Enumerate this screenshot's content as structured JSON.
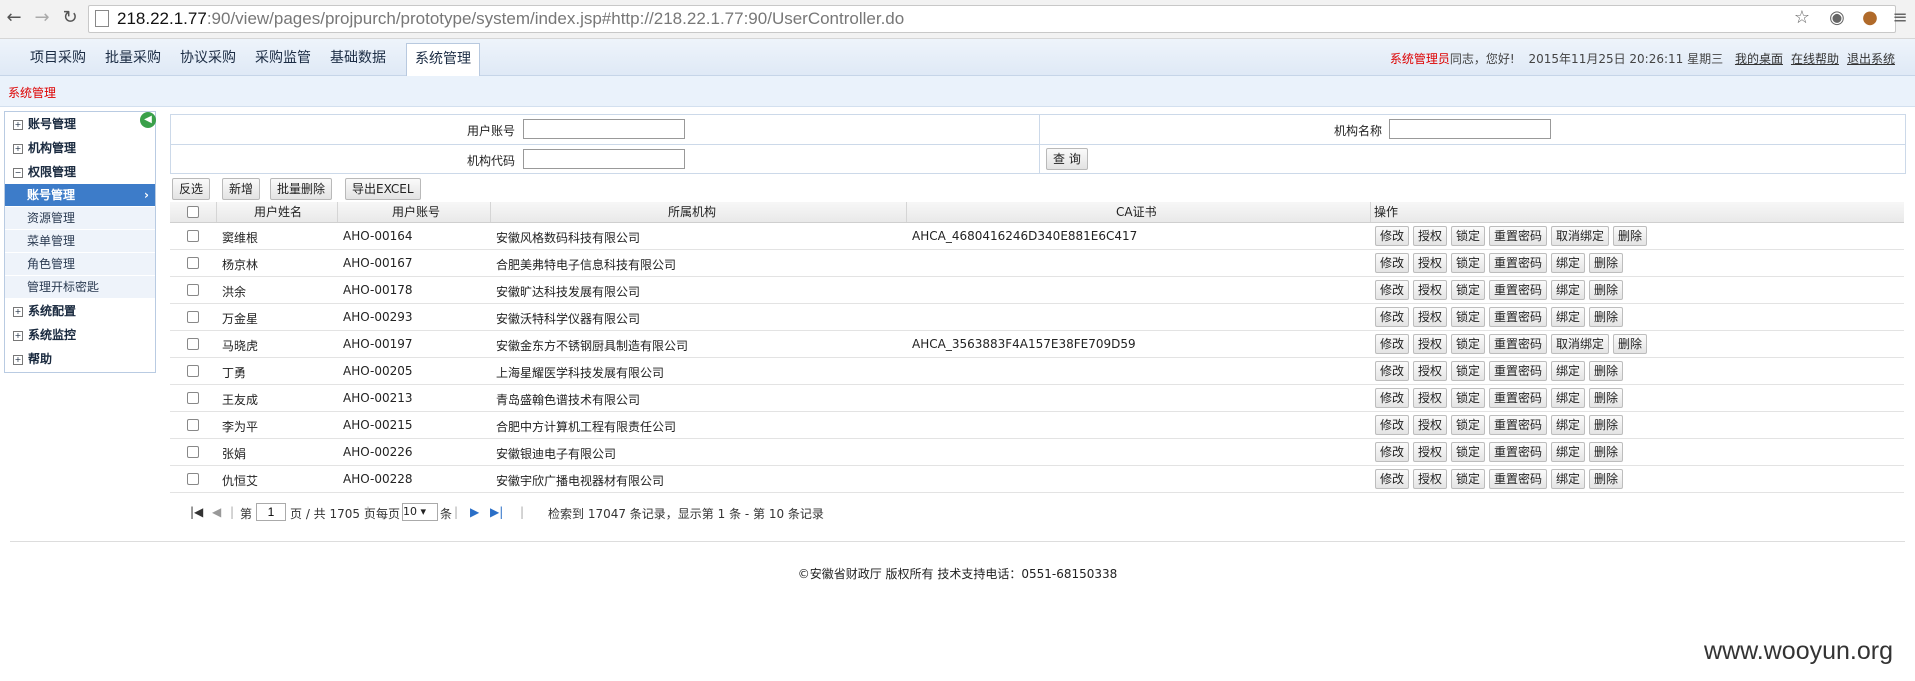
{
  "browser": {
    "url_host": "218.22.1.77",
    "url_rest": ":90/view/pages/projpurch/prototype/system/index.jsp#http://218.22.1.77:90/UserController.do"
  },
  "nav": {
    "tabs": [
      "项目采购",
      "批量采购",
      "协议采购",
      "采购监管",
      "基础数据",
      "系统管理"
    ],
    "active": "系统管理"
  },
  "userbar": {
    "role": "系统管理员",
    "greeting": "同志，您好!",
    "datetime": "2015年11月25日  20:26:11 星期三",
    "links": [
      "我的桌面",
      "在线帮助",
      "退出系统"
    ]
  },
  "breadcrumb": "系统管理",
  "sidebar": [
    {
      "label": "账号管理",
      "type": "group",
      "icon": "plus"
    },
    {
      "label": "机构管理",
      "type": "group",
      "icon": "plus"
    },
    {
      "label": "权限管理",
      "type": "group",
      "icon": "minus"
    },
    {
      "label": "账号管理",
      "type": "sub",
      "active": true
    },
    {
      "label": "资源管理",
      "type": "sub"
    },
    {
      "label": "菜单管理",
      "type": "sub"
    },
    {
      "label": "角色管理",
      "type": "sub"
    },
    {
      "label": "管理开标密匙",
      "type": "sub"
    },
    {
      "label": "系统配置",
      "type": "group",
      "icon": "plus"
    },
    {
      "label": "系统监控",
      "type": "group",
      "icon": "plus"
    },
    {
      "label": "帮助",
      "type": "group",
      "icon": "plus"
    }
  ],
  "search": {
    "account_label": "用户账号",
    "org_name_label": "机构名称",
    "org_code_label": "机构代码",
    "query_button": "查 询"
  },
  "toolbar": [
    "反选",
    "新增",
    "批量删除",
    "导出EXCEL"
  ],
  "table": {
    "headers": [
      "用户姓名",
      "用户账号",
      "所属机构",
      "CA证书",
      "操作"
    ],
    "rows": [
      {
        "name": "窦维根",
        "account": "AHO-00164",
        "org": "安徽风格数码科技有限公司",
        "ca": "AHCA_4680416246D340E881E6C417",
        "actions": [
          "修改",
          "授权",
          "锁定",
          "重置密码",
          "取消绑定",
          "删除"
        ]
      },
      {
        "name": "杨京林",
        "account": "AHO-00167",
        "org": "合肥美弗特电子信息科技有限公司",
        "ca": "",
        "actions": [
          "修改",
          "授权",
          "锁定",
          "重置密码",
          "绑定",
          "删除"
        ]
      },
      {
        "name": "洪余",
        "account": "AHO-00178",
        "org": "安徽旷达科技发展有限公司",
        "ca": "",
        "actions": [
          "修改",
          "授权",
          "锁定",
          "重置密码",
          "绑定",
          "删除"
        ]
      },
      {
        "name": "万金星",
        "account": "AHO-00293",
        "org": "安徽沃特科学仪器有限公司",
        "ca": "",
        "actions": [
          "修改",
          "授权",
          "锁定",
          "重置密码",
          "绑定",
          "删除"
        ]
      },
      {
        "name": "马晓虎",
        "account": "AHO-00197",
        "org": "安徽金东方不锈钢厨具制造有限公司",
        "ca": "AHCA_3563883F4A157E38FE709D59",
        "actions": [
          "修改",
          "授权",
          "锁定",
          "重置密码",
          "取消绑定",
          "删除"
        ]
      },
      {
        "name": "丁勇",
        "account": "AHO-00205",
        "org": "上海星耀医学科技发展有限公司",
        "ca": "",
        "actions": [
          "修改",
          "授权",
          "锁定",
          "重置密码",
          "绑定",
          "删除"
        ]
      },
      {
        "name": "王友成",
        "account": "AHO-00213",
        "org": "青岛盛翰色谱技术有限公司",
        "ca": "",
        "actions": [
          "修改",
          "授权",
          "锁定",
          "重置密码",
          "绑定",
          "删除"
        ]
      },
      {
        "name": "李为平",
        "account": "AHO-00215",
        "org": "合肥中方计算机工程有限责任公司",
        "ca": "",
        "actions": [
          "修改",
          "授权",
          "锁定",
          "重置密码",
          "绑定",
          "删除"
        ]
      },
      {
        "name": "张娟",
        "account": "AHO-00226",
        "org": "安徽银迪电子有限公司",
        "ca": "",
        "actions": [
          "修改",
          "授权",
          "锁定",
          "重置密码",
          "绑定",
          "删除"
        ]
      },
      {
        "name": "仇恒艾",
        "account": "AHO-00228",
        "org": "安徽宇欣广播电视器材有限公司",
        "ca": "",
        "actions": [
          "修改",
          "授权",
          "锁定",
          "重置密码",
          "绑定",
          "删除"
        ]
      }
    ]
  },
  "pager": {
    "page_prefix": "第",
    "page_value": "1",
    "page_suffix": "页 / 共 1705 页",
    "per_page_prefix": "每页",
    "per_page_value": "10",
    "per_page_suffix": "条",
    "summary": "检索到 17047 条记录，显示第 1 条 - 第 10 条记录"
  },
  "footer": "©安徽省财政厅 版权所有 技术支持电话：0551-68150338",
  "watermark": "www.wooyun.org"
}
